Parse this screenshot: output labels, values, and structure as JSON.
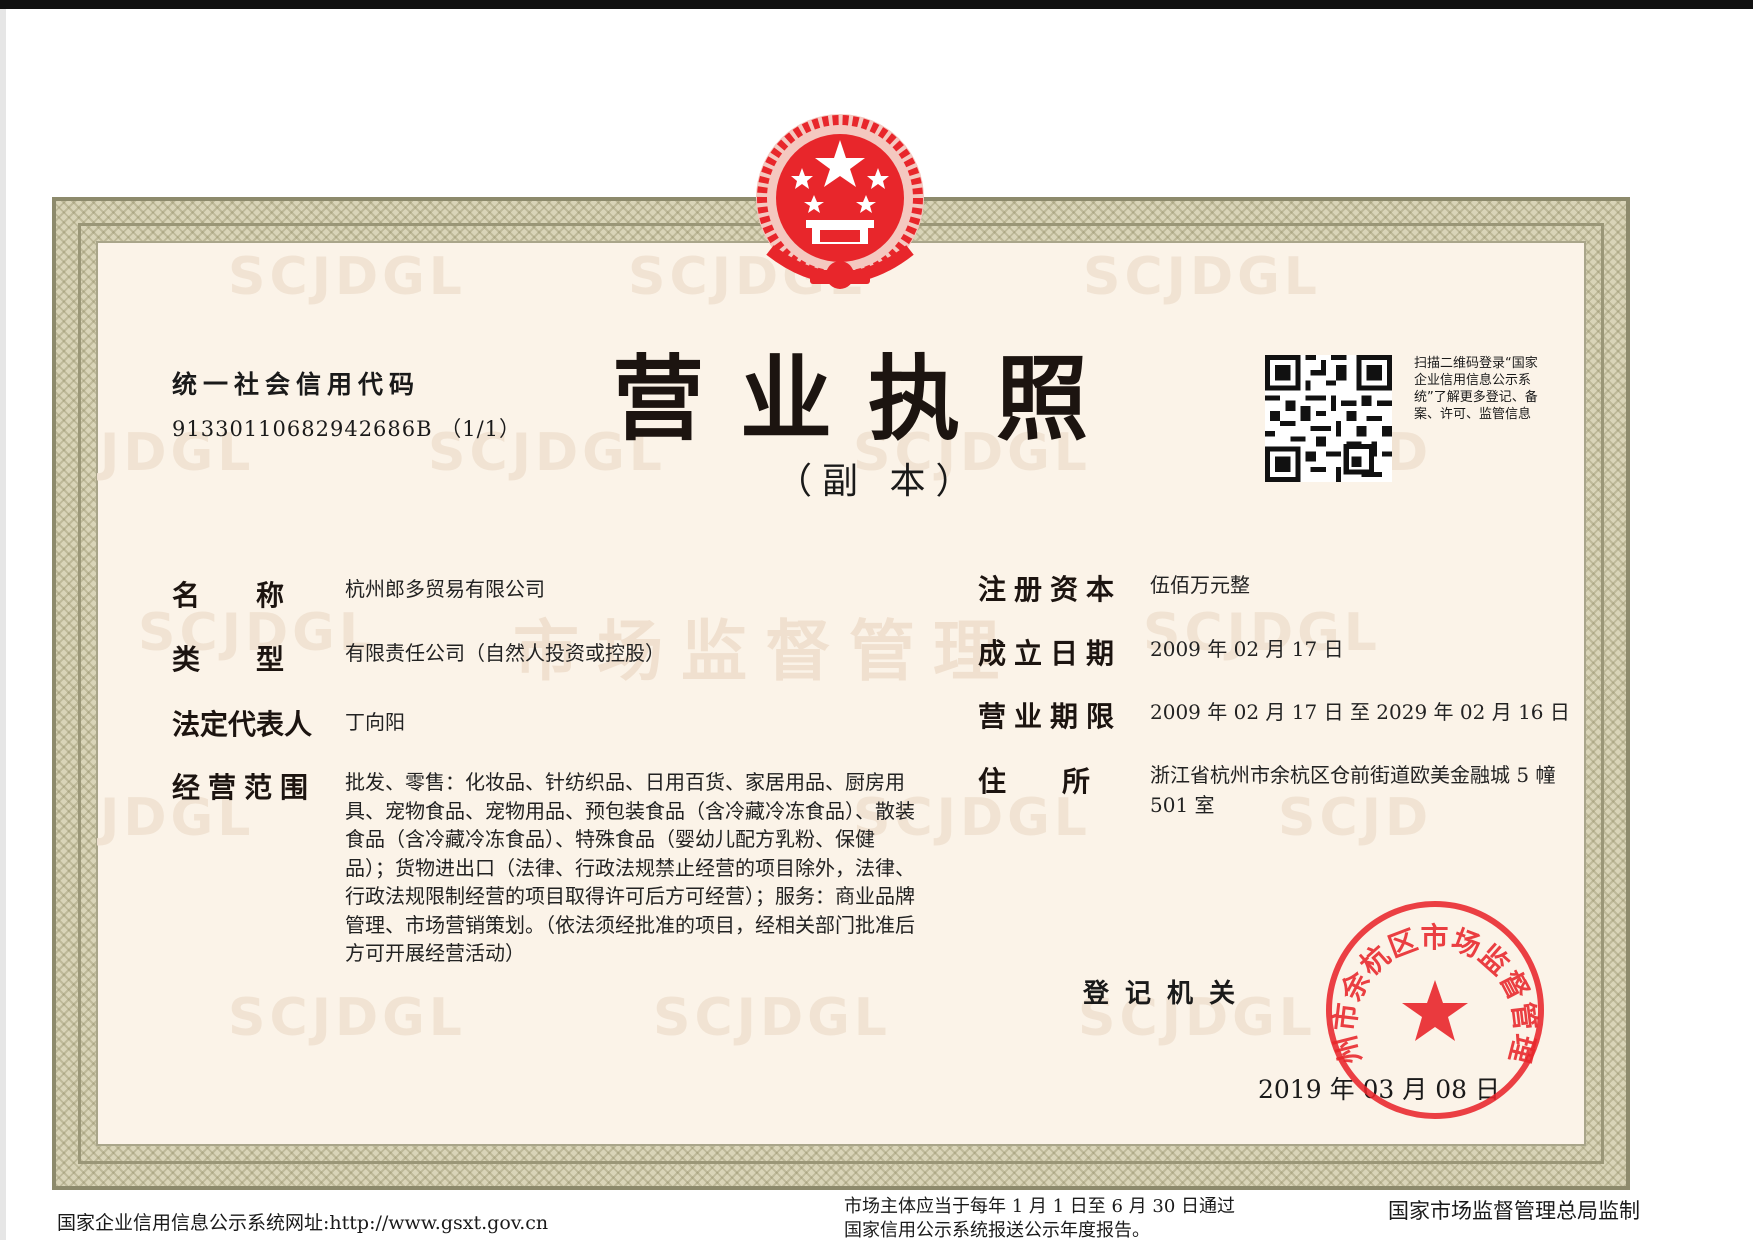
{
  "header": {
    "credit_code_label": "统一社会信用代码",
    "credit_code": "91330110682942686B （1/1）",
    "title": "营业执照",
    "subtitle": "（副 本）",
    "qr_caption": "扫描二维码登录“国家企业信用信息公示系统”了解更多登记、备案、许可、监管信息"
  },
  "watermarks": {
    "latin": "SCJDGL",
    "latin_partial": "JDGL",
    "latin_partial_right": "SCJD",
    "chinese": "市场监督管理"
  },
  "fields": {
    "name_label": "名　　称",
    "name": "杭州郎多贸易有限公司",
    "type_label": "类　　型",
    "type": "有限责任公司（自然人投资或控股）",
    "legal_rep_label": "法定代表人",
    "legal_rep": "丁向阳",
    "scope_label": "经营范围",
    "scope": "批发、零售：化妆品、针纺织品、日用百货、家居用品、厨房用具、宠物食品、宠物用品、预包装食品（含冷藏冷冻食品）、散装食品（含冷藏冷冻食品）、特殊食品（婴幼儿配方乳粉、保健品）；货物进出口（法律、行政法规禁止经营的项目除外，法律、行政法规限制经营的项目取得许可后方可经营）；服务：商业品牌管理、市场营销策划。（依法须经批准的项目，经相关部门批准后方可开展经营活动）",
    "capital_label": "注册资本",
    "capital": "伍佰万元整",
    "established_label": "成立日期",
    "established": "2009 年 02 月 17 日",
    "term_label": "营业期限",
    "term": "2009 年 02 月 17 日  至  2029 年 02 月 16 日",
    "address_label": "住　　所",
    "address": "浙江省杭州市余杭区仓前街道欧美金融城 5 幢 501 室"
  },
  "registration": {
    "authority_label": "登记机关",
    "seal_text": "杭州市余杭区市场监督管理局",
    "issue_date": "2019 年 03 月 08 日"
  },
  "footer": {
    "website": "国家企业信用信息公示系统网址:http://www.gsxt.gov.cn",
    "report_notice_line1": "市场主体应当于每年 1 月 1 日至 6 月 30 日通过",
    "report_notice_line2": "国家信用公示系统报送公示年度报告。",
    "supervisor": "国家市场监督管理总局监制"
  },
  "colors": {
    "seal_red": "#e8262b",
    "frame": "#8d8a6c",
    "paper": "#fbf3e8",
    "watermark": "#f1e3d3"
  }
}
